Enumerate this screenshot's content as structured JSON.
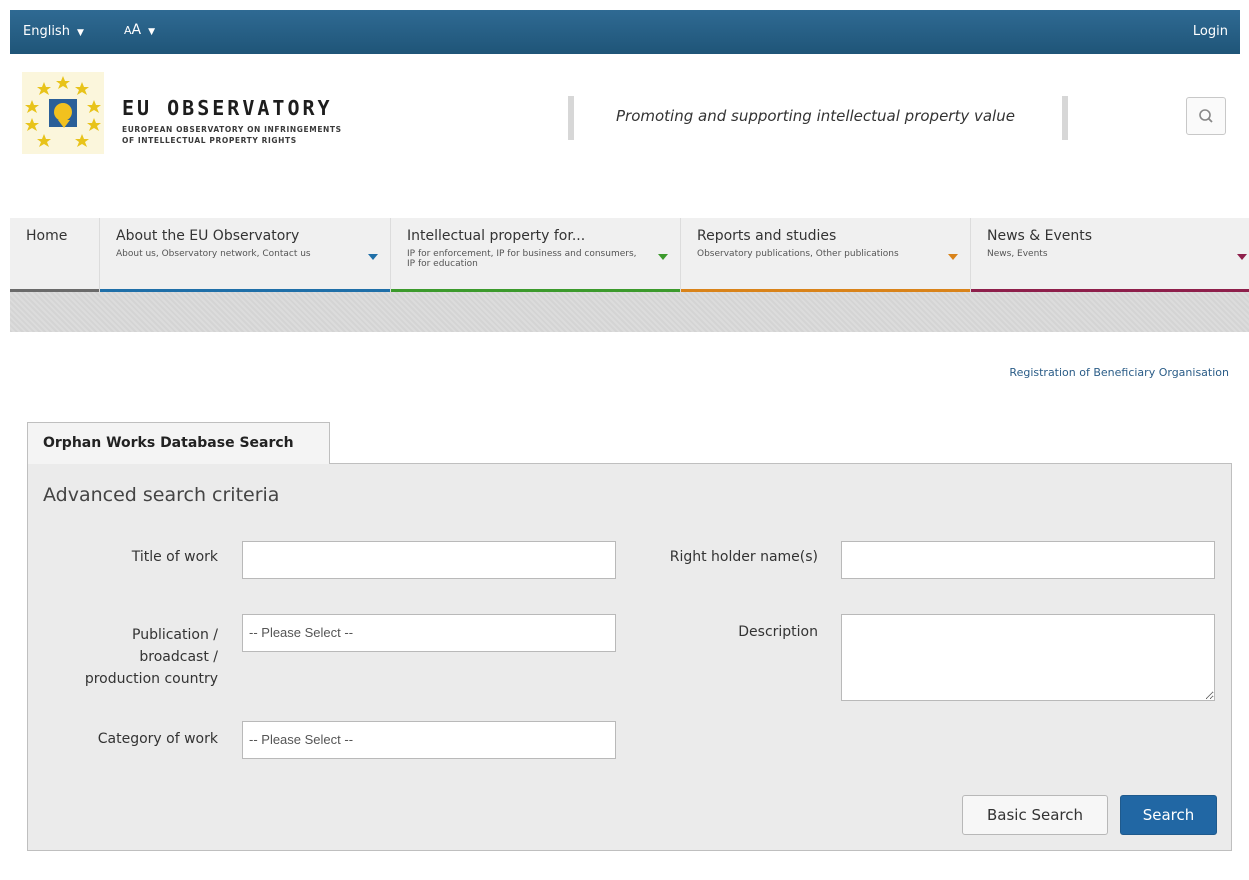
{
  "topbar": {
    "language": "English",
    "font_size": {
      "big": "A",
      "small": "A"
    },
    "login": "Login"
  },
  "header": {
    "brand_title": "EU OBSERVATORY",
    "brand_subtitle_line1": "EUROPEAN OBSERVATORY ON INFRINGEMENTS",
    "brand_subtitle_line2": "OF INTELLECTUAL PROPERTY RIGHTS",
    "tagline": "Promoting and supporting intellectual property value",
    "search_icon": "search-icon"
  },
  "nav": {
    "home": "Home",
    "items": [
      {
        "title": "About the EU Observatory",
        "subtitle": "About us, Observatory network, Contact us",
        "color": "#1f6fa8"
      },
      {
        "title": "Intellectual property for...",
        "subtitle": "IP for enforcement, IP for business and consumers, IP for education",
        "color": "#3c9a2c"
      },
      {
        "title": "Reports and studies",
        "subtitle": "Observatory publications, Other publications",
        "color": "#d9831a"
      },
      {
        "title": "News & Events",
        "subtitle": "News, Events",
        "color": "#8e1f4b"
      }
    ]
  },
  "registration_link": "Registration of Beneficiary Organisation",
  "panel": {
    "tab_label": "Orphan Works Database Search",
    "heading": "Advanced search criteria",
    "fields": {
      "title_label": "Title of work",
      "title_value": "",
      "right_holder_label": "Right holder name(s)",
      "right_holder_value": "",
      "country_label_1": "Publication /",
      "country_label_2": "broadcast /",
      "country_label_3": "production country",
      "country_selected": "-- Please Select --",
      "description_label": "Description",
      "description_value": "",
      "category_label": "Category of work",
      "category_selected": "-- Please Select --"
    },
    "buttons": {
      "basic_search": "Basic Search",
      "search": "Search"
    }
  },
  "colors": {
    "topbar": "#1f5578",
    "primary_button": "#2167a4"
  }
}
